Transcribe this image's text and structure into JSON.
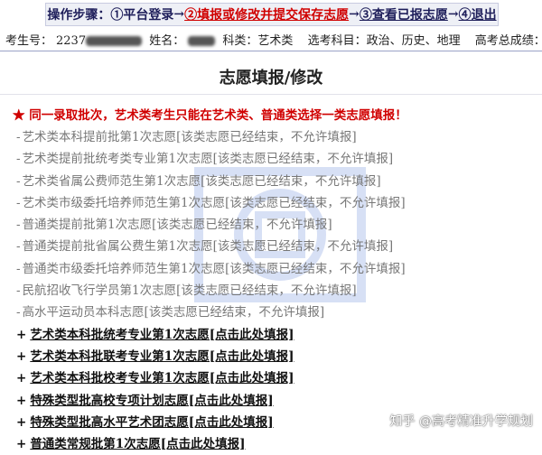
{
  "steps": {
    "label": "操作步骤：",
    "step1": "①平台登录",
    "arrow": "→",
    "step2": "②填报或修改并提交保存志愿",
    "step3": "③查看已报志愿",
    "step4": "④退出"
  },
  "info": {
    "exam_no_label": "考生号：",
    "exam_no_visible": "2237",
    "name_label": "姓名：",
    "subject_label": "科类：",
    "subject_value": "艺术类",
    "elective_label": "选考科目：",
    "elective_value": "政治、历史、地理",
    "score_label": "高考总成绩："
  },
  "page_title": "志愿填报/修改",
  "notice": "★ 同一录取批次，艺术类考生只能在艺术类、普通类选择一类志愿填报！",
  "items": [
    {
      "bullet": "-",
      "text": "艺术类本科提前批第1次志愿[该类志愿已经结束，不允许填报]"
    },
    {
      "bullet": "-",
      "text": "艺术类提前批统考类专业第1次志愿[该类志愿已经结束，不允许填报]"
    },
    {
      "bullet": "-",
      "text": "艺术类省属公费师范生第1次志愿[该类志愿已经结束，不允许填报]"
    },
    {
      "bullet": "-",
      "text": "艺术类市级委托培养师范生第1次志愿[该类志愿已经结束，不允许填报]"
    },
    {
      "bullet": "-",
      "text": "普通类提前批第1次志愿[该类志愿已经结束，不允许填报]"
    },
    {
      "bullet": "-",
      "text": "普通类提前批省属公费生第1次志愿[该类志愿已经结束，不允许填报]"
    },
    {
      "bullet": "-",
      "text": "普通类市级委托培养师范生第1次志愿[该类志愿已经结束，不允许填报]"
    },
    {
      "bullet": "-",
      "text": "民航招收飞行学员第1次志愿[该类志愿已经结束，不允许填报]"
    },
    {
      "bullet": "-",
      "text": "高水平运动员本科志愿[该类志愿已经结束，不允许填报]"
    },
    {
      "bullet": "+",
      "text": "艺术类本科批统考专业第1次志愿[点击此处填报]"
    },
    {
      "bullet": "+",
      "text": "艺术类本科批联考专业第1次志愿[点击此处填报]"
    },
    {
      "bullet": "+",
      "text": "艺术类本科批校考专业第1次志愿[点击此处填报]"
    },
    {
      "bullet": "+",
      "text": "特殊类型批高校专项计划志愿[点击此处填报]"
    },
    {
      "bullet": "+",
      "text": "特殊类型批高水平艺术团志愿[点击此处填报]"
    },
    {
      "bullet": "+",
      "text": "普通类常规批第1次志愿[点击此处填报]"
    }
  ],
  "credit": "知乎 @高考精准升学规划",
  "colors": {
    "accent_red": "#d00000",
    "step_blue": "#1e1e5a",
    "closed_gray": "#777777"
  }
}
